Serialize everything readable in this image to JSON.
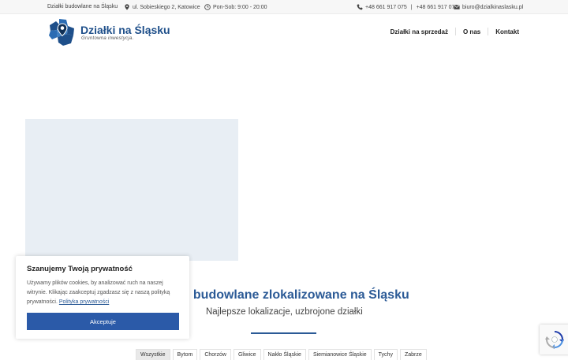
{
  "topbar": {
    "company": "Działki budowlane na Śląsku",
    "address": "ul. Sobieskiego 2, Katowice",
    "hours": "Pon-Sob: 9:00 - 20:00",
    "phone1": "+48 661 917 075",
    "phone_sep": "|",
    "phone2": "+48 661 917 070",
    "email": "biuro@dzialkinaslasku.pl"
  },
  "brand": {
    "name": "Działki na Śląsku",
    "tagline": "Gruntowna inwestycja.",
    "primary_color": "#2b5a96"
  },
  "nav": {
    "items": [
      "Działki na sprzedaż",
      "O nas",
      "Kontakt"
    ]
  },
  "hero": {
    "headline": "i budowlane zlokalizowane na Śląsku",
    "subheadline": "Najlepsze lokalizacje, uzbrojone działki"
  },
  "filters": {
    "items": [
      "Wszystkie",
      "Bytom",
      "Chorzów",
      "Gliwice",
      "Nakło Śląskie",
      "Siemianowice Śląskie",
      "Tychy",
      "Zabrze"
    ],
    "active_index": 0
  },
  "cookie": {
    "title": "Szanujemy Twoją prywatność",
    "text": "Używamy plików cookies, by analizować ruch na naszej witrynie. Klikając zaakceptuj zgadzasz się z naszą polityką prywatności.",
    "link": "Polityka prywatności",
    "accept": "Akceptuje"
  },
  "icons": {
    "address": "map-pin-icon",
    "hours": "clock-icon",
    "phone": "phone-icon",
    "email": "envelope-icon",
    "recaptcha": "recaptcha-icon"
  }
}
